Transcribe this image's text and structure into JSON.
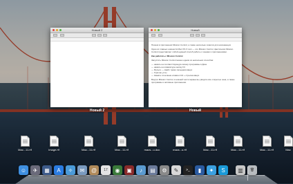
{
  "windows": [
    {
      "title": "Новый 2",
      "label": "Новый 2",
      "document": []
    },
    {
      "title": "Новый",
      "label": "Новый",
      "document": [
        "Пишем в приложении Mission Control, а также несколько советов для начинающих",
        "Один из главных новшеств Mac OS X Lion — это Mission Control, фактически Mission Control представляет собой единый способ работы с окнами и приложениями.",
        "Как работать с Mission Control",
        "Запустить Mission Control можно одним из нескольких способов:",
        "— нажать на соответствующую иконку программы в Доке",
        "— нажать на клавиатуре кнопку F3",
        "— Мульти — свайп тремя пальцами вверх",
        "— Горячие углы",
        "— Нажать сочетание клавиш Ctrl + стрелка вверх",
        "Внутри Mission Control, в нижней части экрана вы увидите все открытые окна, а также программы и активные приложения."
      ]
    }
  ],
  "files": [
    {
      "name": "Mac...11.rtf"
    },
    {
      "name": "Image.rtf"
    },
    {
      "name": "Mac...11.rtf"
    },
    {
      "name": "Mac...11.rtf"
    },
    {
      "name": "macs...u.doc"
    },
    {
      "name": "macs...u.rtf"
    },
    {
      "name": "Mac...11.rtf"
    },
    {
      "name": "Mac...11.rtf"
    },
    {
      "name": "Mac...11.rtf"
    },
    {
      "name": "Mac"
    }
  ],
  "dock": [
    {
      "name": "finder-icon",
      "glyph": "☺",
      "color": "#3f8fe0"
    },
    {
      "name": "launchpad-icon",
      "glyph": "✈",
      "color": "#6a6a7a"
    },
    {
      "name": "mission-control-icon",
      "glyph": "▦",
      "color": "#3c5a8a"
    },
    {
      "name": "app-store-icon",
      "glyph": "A",
      "color": "#2a7be0"
    },
    {
      "name": "safari-icon",
      "glyph": "✧",
      "color": "#4a9ad8"
    },
    {
      "name": "mail-icon",
      "glyph": "✉",
      "color": "#7a9abf"
    },
    {
      "name": "contacts-icon",
      "glyph": "@",
      "color": "#b08a5a"
    },
    {
      "name": "calendar-icon",
      "glyph": "17",
      "color": "#e4e4e4"
    },
    {
      "name": "facetime-icon",
      "glyph": "◉",
      "color": "#3a7a3a"
    },
    {
      "name": "photo-booth-icon",
      "glyph": "▣",
      "color": "#8a2a2a"
    },
    {
      "name": "itunes-icon",
      "glyph": "♪",
      "color": "#5a9ad0"
    },
    {
      "name": "preview-icon",
      "glyph": "▤",
      "color": "#6a7a9a"
    },
    {
      "name": "system-preferences-icon",
      "glyph": "⚙",
      "color": "#8a8a8a"
    },
    {
      "name": "textedit-icon",
      "glyph": "✎",
      "color": "#d8d8d8"
    },
    {
      "name": "terminal-icon",
      "glyph": ">_",
      "color": "#222"
    },
    {
      "name": "keynote-icon",
      "glyph": "▮",
      "color": "#2a5aa0"
    },
    {
      "name": "twitter-icon",
      "glyph": "✦",
      "color": "#3aa0e0"
    },
    {
      "name": "skype-icon",
      "glyph": "S",
      "color": "#1a9ad8"
    },
    {
      "name": "downloads-stack-icon",
      "glyph": "▥",
      "color": "#c8c8c8"
    },
    {
      "name": "trash-icon",
      "glyph": "🗑",
      "color": "#b8bcc0"
    }
  ]
}
